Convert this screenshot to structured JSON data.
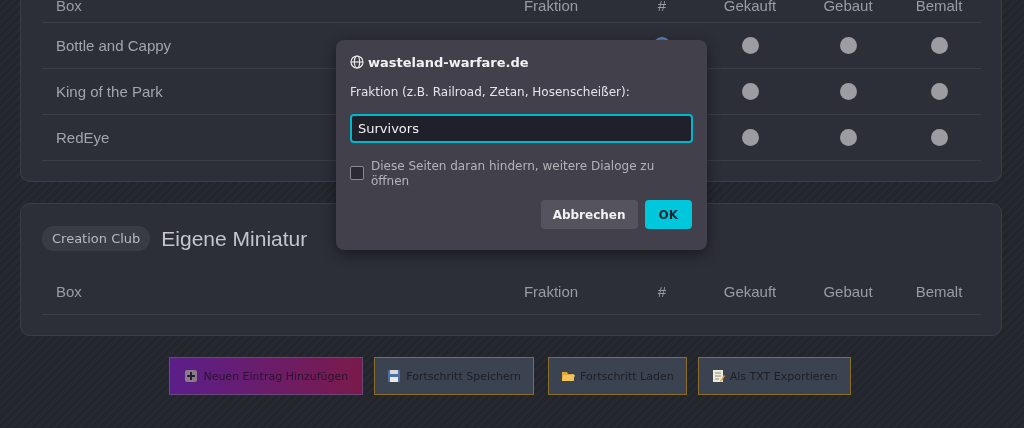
{
  "sections": [
    {
      "columns": [
        "Box",
        "Fraktion",
        "#",
        "Gekauft",
        "Gebaut",
        "Bemalt"
      ],
      "rows": [
        {
          "box": "Bottle and Cappy",
          "number_marker": {
            "selected": true
          },
          "gekauft": false,
          "gebaut": false,
          "bemalt": false
        },
        {
          "box": "King of the Park",
          "gekauft": false,
          "gebaut": false,
          "bemalt": false
        },
        {
          "box": "RedEye",
          "gekauft": false,
          "gebaut": false,
          "bemalt": false
        }
      ]
    },
    {
      "badge": "Creation Club",
      "title": "Eigene Miniatur",
      "columns": [
        "Box",
        "Fraktion",
        "#",
        "Gekauft",
        "Gebaut",
        "Bemalt"
      ]
    }
  ],
  "actions": [
    {
      "kind": "add",
      "label": "Neuen Eintrag Hinzufügen"
    },
    {
      "kind": "save",
      "label": "Fortschritt Speichern"
    },
    {
      "kind": "load",
      "label": "Fortschritt Laden"
    },
    {
      "kind": "export",
      "label": "Als TXT Exportieren"
    }
  ],
  "dialog": {
    "origin": "wasteland-warfare.de",
    "prompt": "Fraktion (z.B. Railroad, Zetan, Hosenscheißer):",
    "value": "Survivors",
    "suppress": {
      "label": "Diese Seiten daran hindern, weitere Dialoge zu öffnen",
      "checked": false
    },
    "buttons": [
      {
        "label": "Abbrechen",
        "kind": "secondary"
      },
      {
        "label": "OK",
        "kind": "primary"
      }
    ]
  }
}
